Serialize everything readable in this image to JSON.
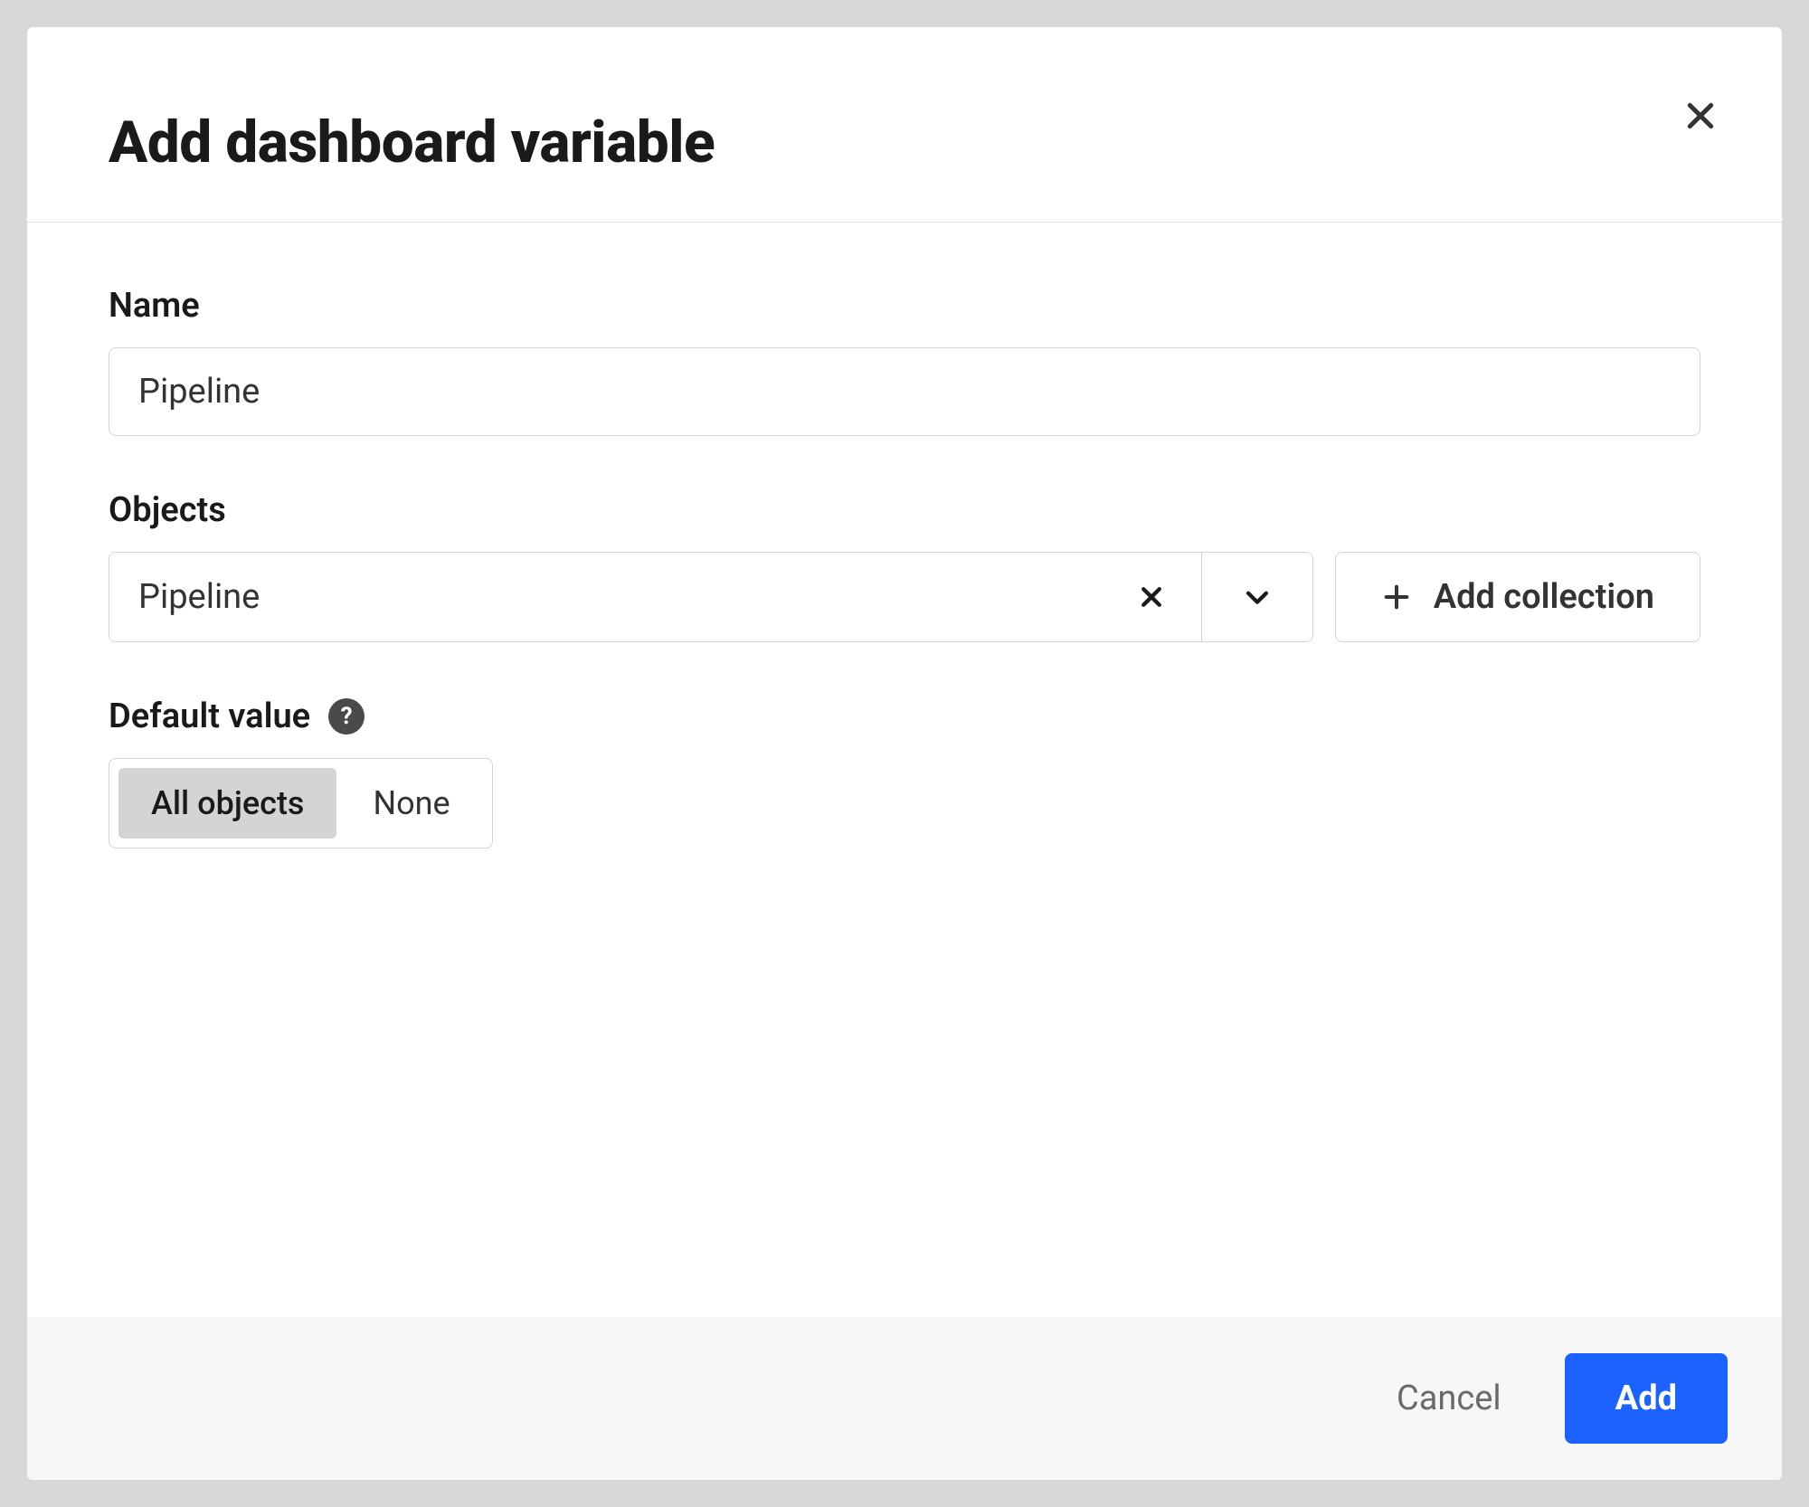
{
  "modal": {
    "title": "Add dashboard variable",
    "fields": {
      "name": {
        "label": "Name",
        "value": "Pipeline"
      },
      "objects": {
        "label": "Objects",
        "selected": "Pipeline",
        "add_collection_label": "Add collection"
      },
      "default_value": {
        "label": "Default value",
        "options": {
          "all_objects": "All objects",
          "none": "None"
        },
        "selected": "all_objects"
      }
    },
    "footer": {
      "cancel": "Cancel",
      "add": "Add"
    },
    "help_icon_text": "?"
  }
}
